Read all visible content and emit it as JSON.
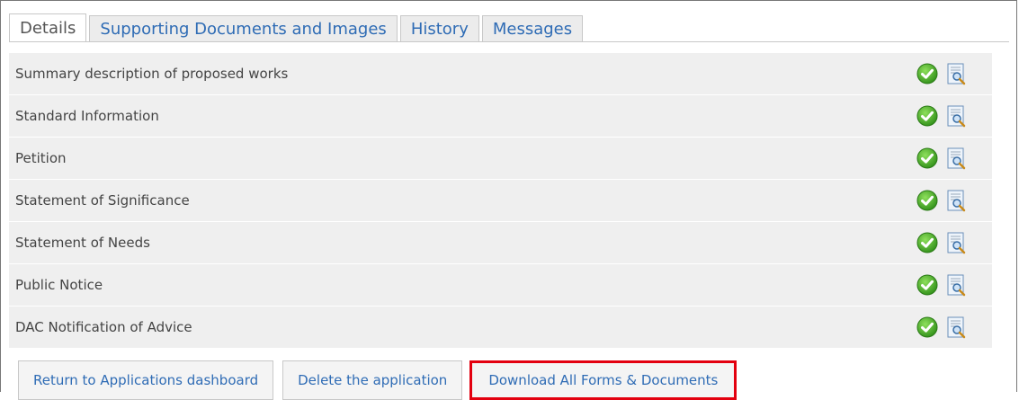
{
  "tabs": [
    {
      "label": "Details",
      "active": true
    },
    {
      "label": "Supporting Documents and Images",
      "active": false
    },
    {
      "label": "History",
      "active": false
    },
    {
      "label": "Messages",
      "active": false
    }
  ],
  "rows": [
    {
      "label": "Summary description of proposed works",
      "status_icon": "check-circle-icon",
      "action_icon": "view-document-icon"
    },
    {
      "label": "Standard Information",
      "status_icon": "check-circle-icon",
      "action_icon": "view-document-icon"
    },
    {
      "label": "Petition",
      "status_icon": "check-circle-icon",
      "action_icon": "view-document-icon"
    },
    {
      "label": "Statement of Significance",
      "status_icon": "check-circle-icon",
      "action_icon": "view-document-icon"
    },
    {
      "label": "Statement of Needs",
      "status_icon": "check-circle-icon",
      "action_icon": "view-document-icon"
    },
    {
      "label": "Public Notice",
      "status_icon": "check-circle-icon",
      "action_icon": "view-document-icon"
    },
    {
      "label": "DAC Notification of Advice",
      "status_icon": "check-circle-icon",
      "action_icon": "view-document-icon"
    }
  ],
  "buttons": {
    "return_label": "Return to Applications dashboard",
    "delete_label": "Delete the application",
    "download_label": "Download All Forms & Documents"
  },
  "colors": {
    "link": "#2f6cb5",
    "row_bg": "#efefef",
    "check_green": "#4cae2a",
    "highlight_red": "#e3000f"
  }
}
